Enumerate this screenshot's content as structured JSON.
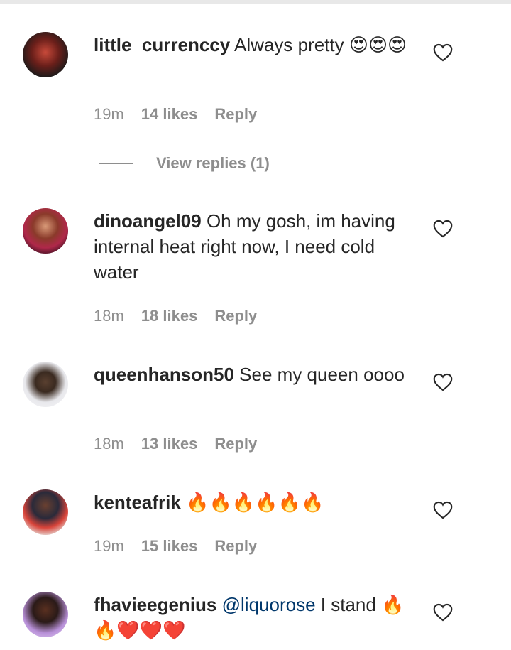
{
  "comments": [
    {
      "username": "little_currenccy",
      "mention": "",
      "text": "Always pretty 😍😍😍",
      "time": "19m",
      "likes": "14 likes",
      "reply": "Reply",
      "view_replies": "View replies (1)"
    },
    {
      "username": "dinoangel09",
      "mention": "",
      "text": "Oh my gosh, im having internal heat right now, I need cold water",
      "time": "18m",
      "likes": "18 likes",
      "reply": "Reply"
    },
    {
      "username": "queenhanson50",
      "mention": "",
      "text": "See my queen oooo",
      "time": "18m",
      "likes": "13 likes",
      "reply": "Reply"
    },
    {
      "username": "kenteafrik",
      "mention": "",
      "text": "🔥🔥🔥🔥🔥🔥",
      "time": "19m",
      "likes": "15 likes",
      "reply": "Reply"
    },
    {
      "username": "fhavieegenius",
      "mention": "@liquorose",
      "text": "I stand 🔥🔥❤️❤️❤️",
      "time": "",
      "likes": "",
      "reply": ""
    }
  ],
  "colors": {
    "text": "#262626",
    "meta": "#8e8e8e",
    "mention": "#00376b"
  },
  "icons": [
    "heart-outline-icon",
    "avatar"
  ]
}
